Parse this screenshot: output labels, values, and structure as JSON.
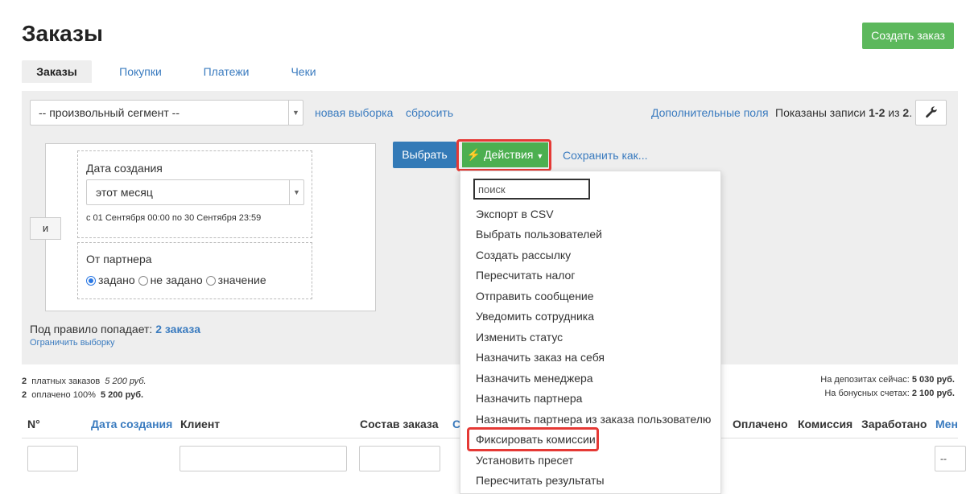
{
  "page": {
    "title": "Заказы",
    "create_button": "Создать заказ"
  },
  "tabs": [
    "Заказы",
    "Покупки",
    "Платежи",
    "Чеки"
  ],
  "filter": {
    "segment": "-- произвольный сегмент --",
    "new_selection": "новая выборка",
    "reset": "сбросить",
    "extra_fields": "Дополнительные поля",
    "records_prefix": "Показаны записи ",
    "records_range": "1-2",
    "records_of": " из ",
    "records_total": "2",
    "records_end": ".",
    "and_label": "и",
    "rule1": {
      "label": "Дата создания",
      "value": "этот месяц",
      "hint": "с 01 Сентября 00:00 по 30 Сентября 23:59"
    },
    "rule2": {
      "label": "От партнера",
      "options": [
        "задано",
        "не задано",
        "значение"
      ],
      "selected": "задано"
    },
    "match_prefix": "Под правило попадает: ",
    "match_count": "2 заказа",
    "limit": "Ограничить выборку"
  },
  "toolbar": {
    "choose": "Выбрать",
    "actions": "Действия",
    "save_as": "Сохранить как..."
  },
  "menu": {
    "search_placeholder": "поиск",
    "items": [
      "Экспорт в CSV",
      "Выбрать пользователей",
      "Создать рассылку",
      "Пересчитать налог",
      "Отправить сообщение",
      "Уведомить сотрудника",
      "Изменить статус",
      "Назначить заказ на себя",
      "Назначить менеджера",
      "Назначить партнера",
      "Назначить партнера из заказа пользователю",
      "Фиксировать комиссии",
      "Установить пресет",
      "Пересчитать результаты"
    ],
    "highlighted": "Фиксировать комиссии"
  },
  "summary": {
    "left1_count": "2",
    "left1_label": "платных заказов",
    "left1_sum": "5 200 руб.",
    "left2_count": "2",
    "left2_label": "оплачено 100%",
    "left2_sum": "5 200 руб.",
    "deposit_label": "На депозитах сейчас: ",
    "deposit_value": "5 030 руб.",
    "bonus_label": "На бонусных счетах: ",
    "bonus_value": "2 100 руб."
  },
  "table": {
    "headers": [
      "N°",
      "Дата создания",
      "Клиент",
      "Состав заказа",
      "С",
      "Оплачено",
      "Комиссия",
      "Заработано",
      "Мен"
    ]
  },
  "colors": {
    "accent_green": "#4caf50",
    "primary_blue": "#337ab7",
    "highlight_red": "#e53935"
  }
}
